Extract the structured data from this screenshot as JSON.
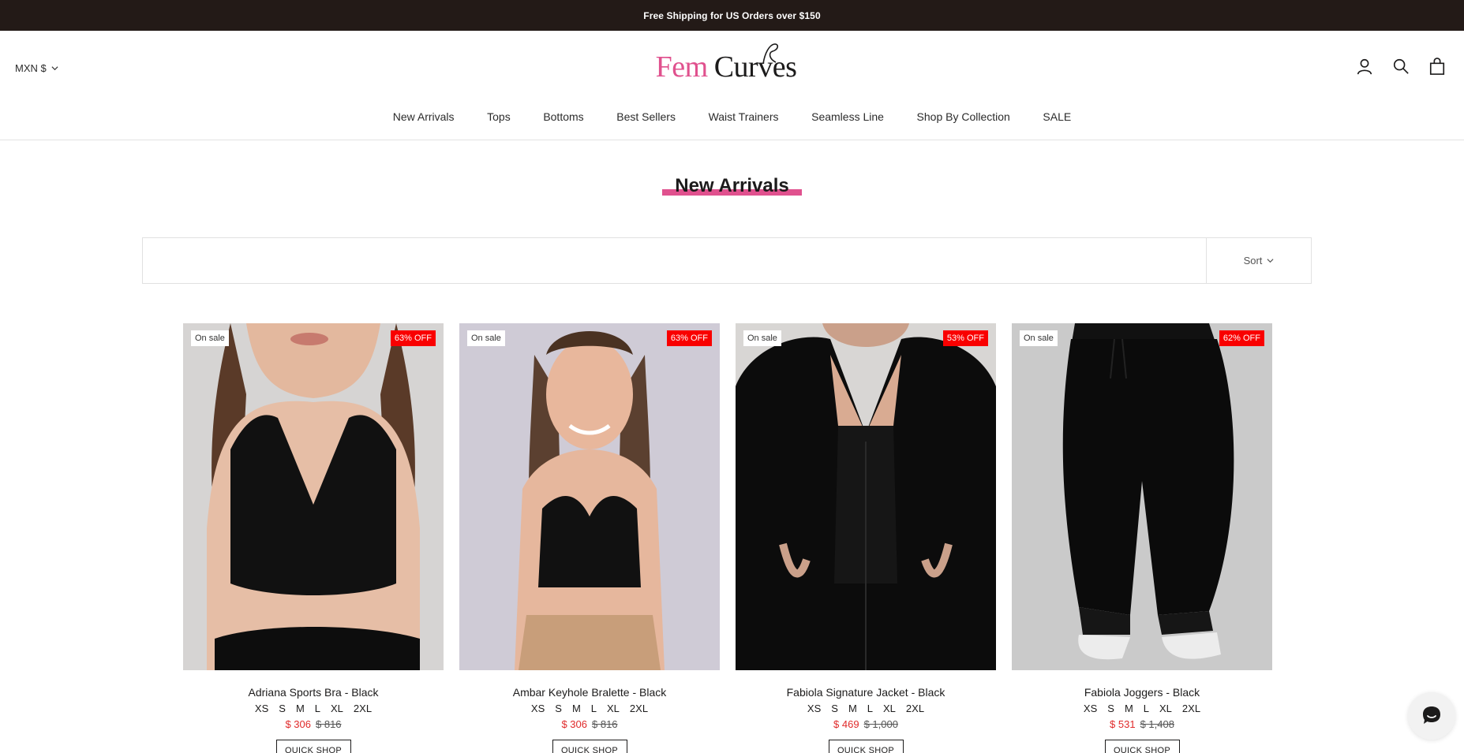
{
  "announcement": "Free Shipping for US Orders over $150",
  "currency": "MXN $",
  "logo": {
    "part1": "Fem",
    "part2": "Curves"
  },
  "nav": [
    "New Arrivals",
    "Tops",
    "Bottoms",
    "Best Sellers",
    "Waist Trainers",
    "Seamless Line",
    "Shop By Collection",
    "SALE"
  ],
  "page_title": "New Arrivals",
  "toolbar": {
    "sort_label": "Sort"
  },
  "products": [
    {
      "title": "Adriana Sports Bra - Black",
      "sale_badge": "On sale",
      "discount": "63% OFF",
      "sizes": [
        "XS",
        "S",
        "M",
        "L",
        "XL",
        "2XL"
      ],
      "price": "$ 306",
      "compare_price": "$ 816",
      "cta": "QUICK SHOP"
    },
    {
      "title": "Ambar Keyhole Bralette - Black",
      "sale_badge": "On sale",
      "discount": "63% OFF",
      "sizes": [
        "XS",
        "S",
        "M",
        "L",
        "XL",
        "2XL"
      ],
      "price": "$ 306",
      "compare_price": "$ 816",
      "cta": "QUICK SHOP"
    },
    {
      "title": "Fabiola Signature Jacket - Black",
      "sale_badge": "On sale",
      "discount": "53% OFF",
      "sizes": [
        "XS",
        "S",
        "M",
        "L",
        "XL",
        "2XL"
      ],
      "price": "$ 469",
      "compare_price": "$ 1,000",
      "cta": "QUICK SHOP"
    },
    {
      "title": "Fabiola Joggers - Black",
      "sale_badge": "On sale",
      "discount": "62% OFF",
      "sizes": [
        "XS",
        "S",
        "M",
        "L",
        "XL",
        "2XL"
      ],
      "price": "$ 531",
      "compare_price": "$ 1,408",
      "cta": "QUICK SHOP"
    }
  ],
  "colors": {
    "brand_pink": "#e0518e",
    "sale_red": "#f90000",
    "announce_bg": "#231a17"
  }
}
